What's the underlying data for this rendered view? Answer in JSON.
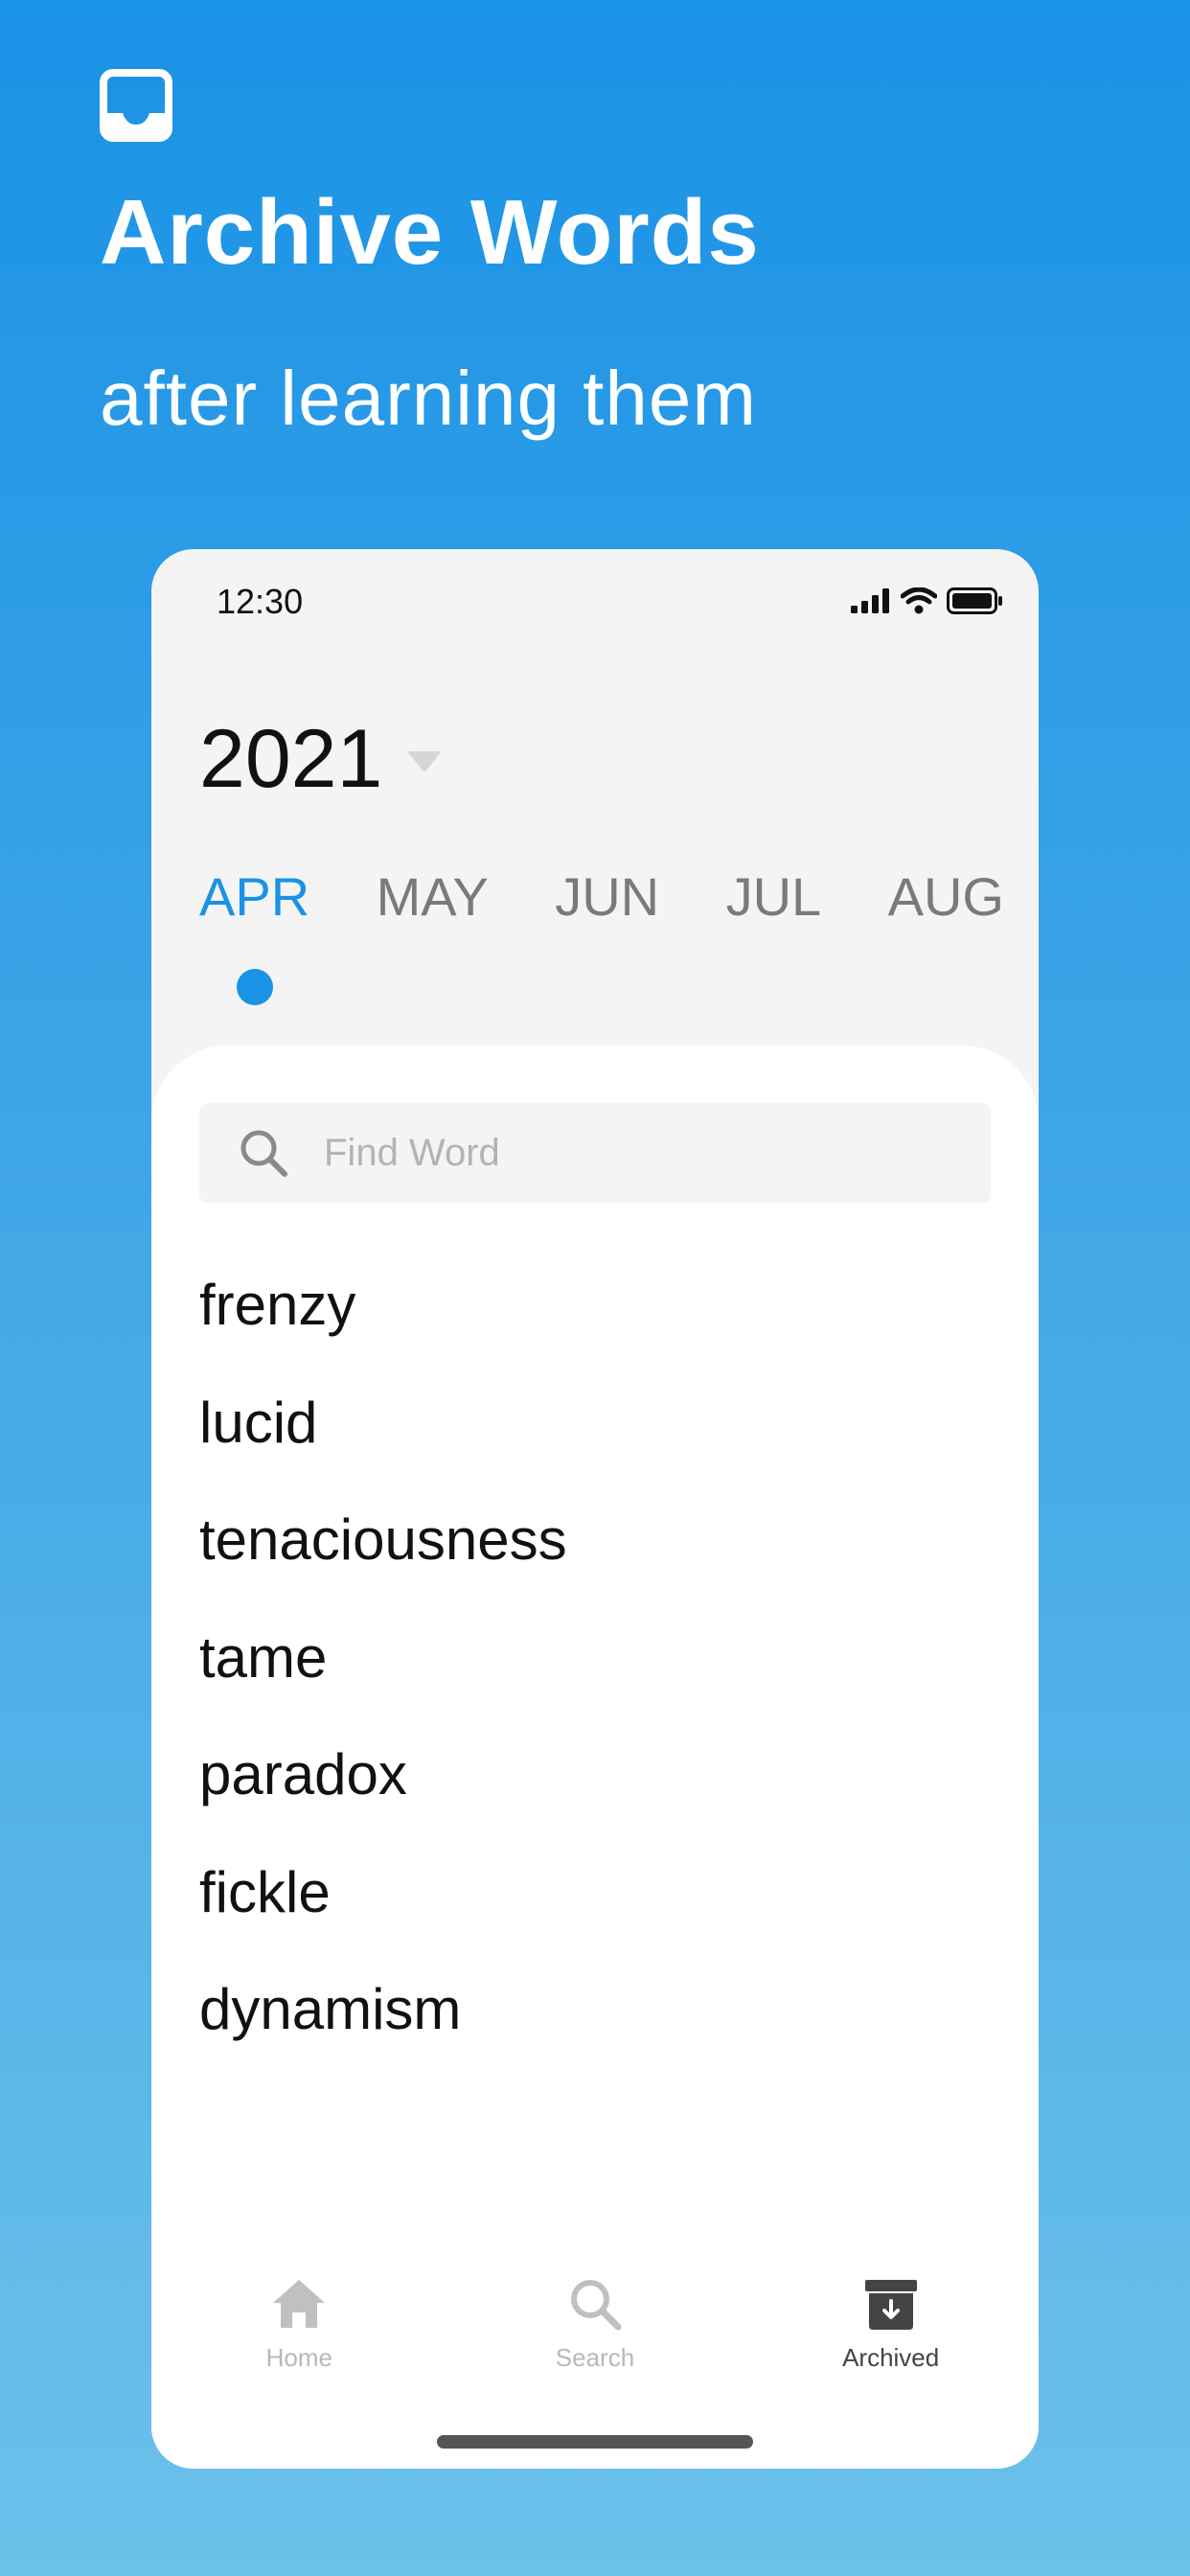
{
  "promo": {
    "icon": "inbox-tray-icon",
    "title": "Archive Words",
    "subtitle": "after learning them"
  },
  "status_bar": {
    "time": "12:30",
    "icons": [
      "signal-icon",
      "wifi-icon",
      "battery-icon"
    ]
  },
  "year_selector": {
    "year": "2021",
    "icon": "caret-down-icon"
  },
  "months": {
    "items": [
      "APR",
      "MAY",
      "JUN",
      "JUL",
      "AUG"
    ],
    "selected": "APR"
  },
  "search": {
    "placeholder": "Find Word",
    "value": "",
    "icon": "search-icon"
  },
  "words": [
    "frenzy",
    "lucid",
    "tenaciousness",
    "tame",
    "paradox",
    "fickle",
    "dynamism"
  ],
  "tabbar": {
    "tabs": [
      {
        "label": "Home",
        "icon": "home-icon"
      },
      {
        "label": "Search",
        "icon": "search-icon"
      },
      {
        "label": "Archived",
        "icon": "archive-box-icon"
      }
    ],
    "active": "Archived"
  },
  "colors": {
    "accent": "#1a92e6",
    "background_top": "#1a92e6",
    "background_bottom": "#6cc1ea",
    "active_tab": "#444444",
    "inactive_tab": "#b8b8b8"
  }
}
